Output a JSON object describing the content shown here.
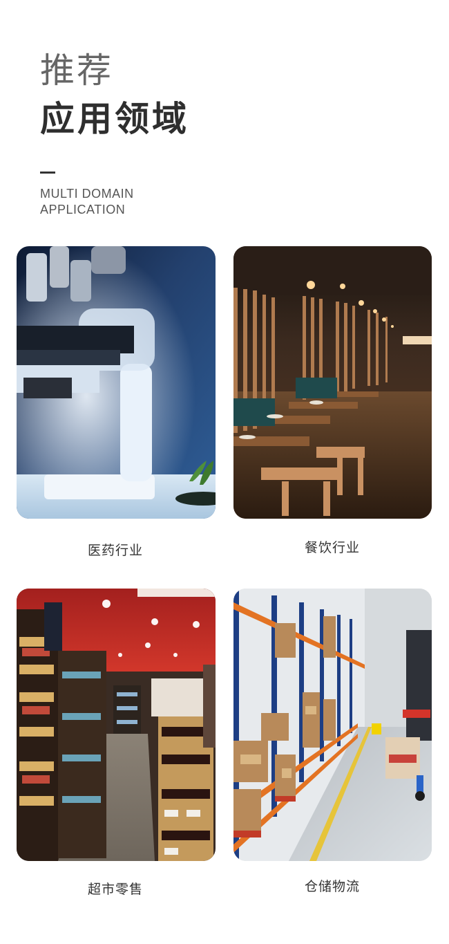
{
  "header": {
    "title_light": "推荐",
    "title_bold": "应用领域",
    "subtitle_line1": "MULTI DOMAIN",
    "subtitle_line2": "APPLICATION"
  },
  "domains": [
    {
      "label": "医药行业",
      "image": "microscope-photo"
    },
    {
      "label": "餐饮行业",
      "image": "restaurant-photo"
    },
    {
      "label": "超市零售",
      "image": "supermarket-photo"
    },
    {
      "label": "仓储物流",
      "image": "warehouse-photo"
    }
  ]
}
